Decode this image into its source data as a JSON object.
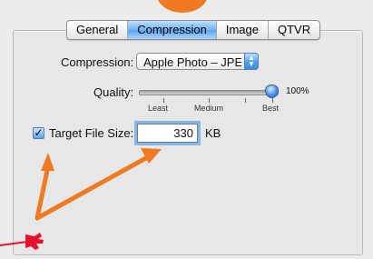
{
  "tabs": [
    {
      "label": "General"
    },
    {
      "label": "Compression",
      "active": true
    },
    {
      "label": "Image"
    },
    {
      "label": "QTVR"
    }
  ],
  "compression": {
    "label": "Compression:",
    "value": "Apple Photo – JPEG"
  },
  "quality": {
    "label": "Quality:",
    "value_text": "100%",
    "level": 1.0,
    "ticks": {
      "least": "Least",
      "medium": "Medium",
      "best": "Best"
    }
  },
  "target_size": {
    "label": "Target File Size:",
    "checked": true,
    "value": "330",
    "unit": "KB"
  },
  "annotation": {
    "arrow_color": "#f07a22",
    "cursor_icon": "pointing-hand-icon"
  }
}
